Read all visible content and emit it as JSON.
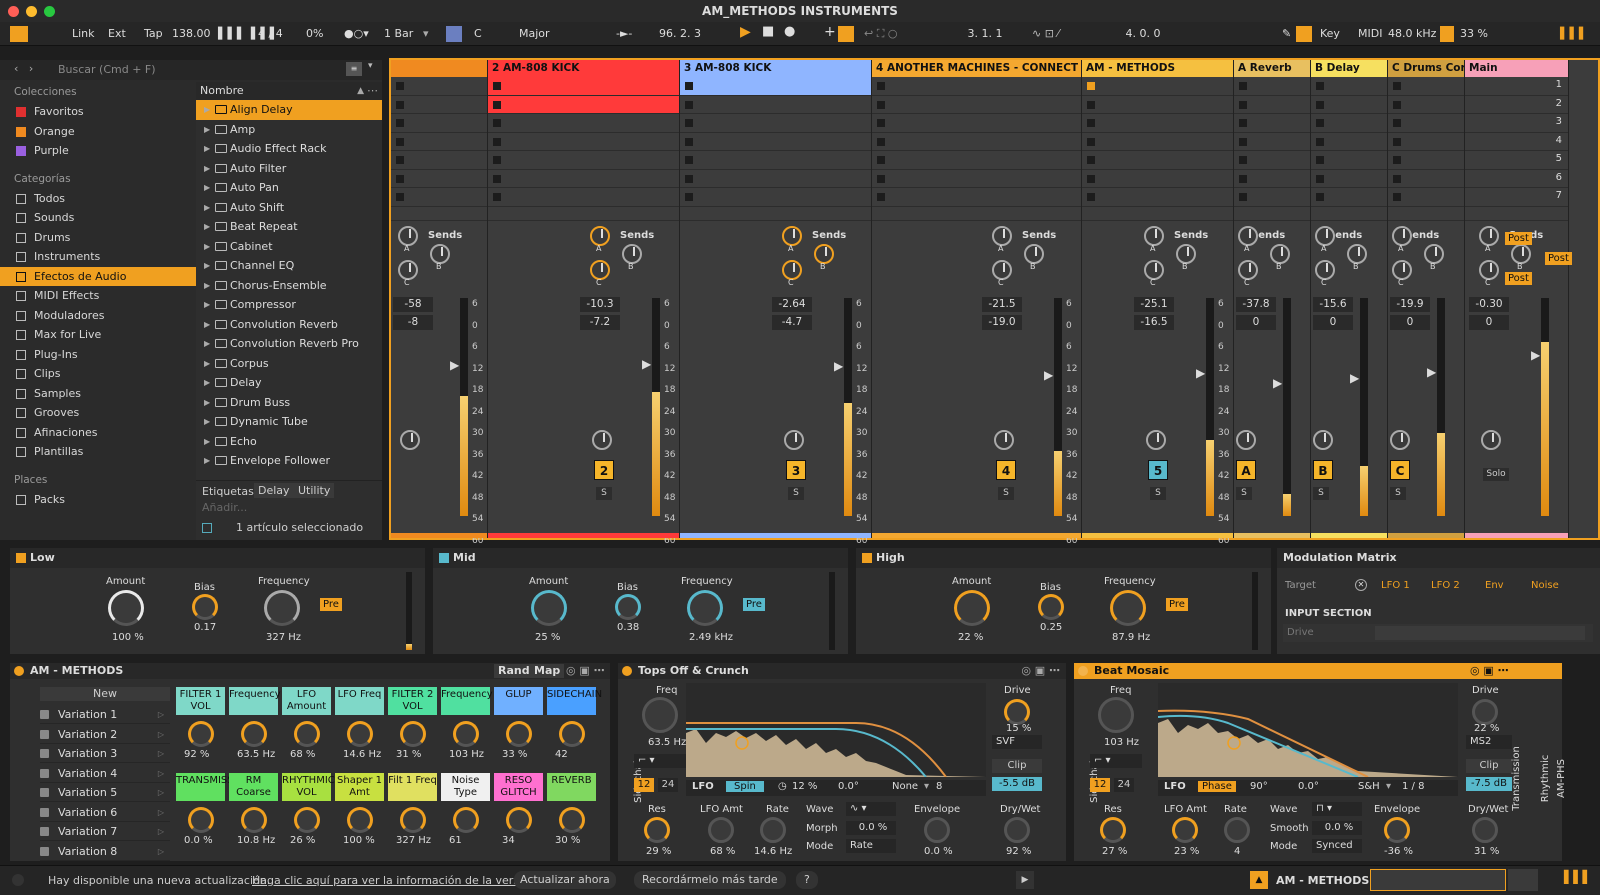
{
  "window": {
    "title": "AM_METHODS INSTRUMENTS"
  },
  "transport": {
    "link": "Link",
    "ext": "Ext",
    "tap": "Tap",
    "tempo": "138.00",
    "signature": "4 / 4",
    "groove": "0%",
    "quant": "1 Bar",
    "key": "C",
    "scale": "Major",
    "position": "96.  2.  3",
    "loop_start": "3.  1.  1",
    "loop_length": "4.  0.  0",
    "key_btn": "Key",
    "midi_btn": "MIDI",
    "sample_rate": "48.0 kHz",
    "cpu": "33 %"
  },
  "browser": {
    "search_placeholder": "Buscar (Cmd + F)",
    "collections_head": "Colecciones",
    "collections": [
      {
        "label": "Favoritos",
        "color": "#e03030"
      },
      {
        "label": "Orange",
        "color": "#f08a20"
      },
      {
        "label": "Purple",
        "color": "#9a60e0"
      }
    ],
    "categories_head": "Categorías",
    "categories": [
      "Todos",
      "Sounds",
      "Drums",
      "Instruments",
      "Efectos de Audio",
      "MIDI Effects",
      "Moduladores",
      "Max for Live",
      "Plug-Ins",
      "Clips",
      "Samples",
      "Grooves",
      "Afinaciones",
      "Plantillas"
    ],
    "places_head": "Places",
    "places": [
      "Packs"
    ],
    "column_head": "Nombre",
    "files": [
      "Align Delay",
      "Amp",
      "Audio Effect Rack",
      "Auto Filter",
      "Auto Pan",
      "Auto Shift",
      "Beat Repeat",
      "Cabinet",
      "Channel EQ",
      "Chorus-Ensemble",
      "Compressor",
      "Convolution Reverb",
      "Convolution Reverb Pro",
      "Corpus",
      "Delay",
      "Drum Buss",
      "Dynamic Tube",
      "Echo",
      "Envelope Follower"
    ],
    "tags_label": "Etiquetas:",
    "tags": [
      "Delay",
      "Utility"
    ],
    "add_tag": "Añadir...",
    "selected_info": "1 artículo seleccionado"
  },
  "session": {
    "tracks": [
      {
        "name": "",
        "color": "#f08a20",
        "vol": "-58",
        "pan": "-8",
        "num": "",
        "meter": 0.55
      },
      {
        "name": "2 AM-808 KICK",
        "color": "#ff3a3a",
        "vol": "-10.3",
        "pan": "-7.2",
        "num": "2",
        "meter": 0.57
      },
      {
        "name": "3 AM-808 KICK",
        "color": "#8fb5ff",
        "vol": "-2.64",
        "pan": "-4.7",
        "num": "3",
        "meter": 0.52
      },
      {
        "name": "4 ANOTHER MACHINES - CONNECT",
        "color": "#f4a830",
        "vol": "-21.5",
        "pan": "-19.0",
        "num": "4",
        "meter": 0.3
      },
      {
        "name": "AM - METHODS",
        "color": "#f5c040",
        "vol": "-25.1",
        "pan": "-16.5",
        "num": "5",
        "meter": 0.35
      },
      {
        "name": "A Reverb",
        "color": "#e8c060",
        "vol": "-37.8",
        "pan": "0",
        "num": "A",
        "meter": 0.1
      },
      {
        "name": "B Delay",
        "color": "#f6e060",
        "vol": "-15.6",
        "pan": "0",
        "num": "B",
        "meter": 0.23
      },
      {
        "name": "C Drums Core",
        "color": "#d0a040",
        "vol": "-19.9",
        "pan": "0",
        "num": "C",
        "meter": 0.38
      },
      {
        "name": "Main",
        "color": "#f7a0b8",
        "vol": "-0.30",
        "pan": "0",
        "num": "",
        "meter": 0.8
      }
    ],
    "sends_label": "Sends",
    "scale": [
      "6",
      "0",
      "6",
      "12",
      "18",
      "24",
      "30",
      "36",
      "42",
      "48",
      "54",
      "60"
    ],
    "scene_numbers": [
      "1",
      "2",
      "3",
      "4",
      "5",
      "6",
      "7"
    ],
    "post_label": "Post",
    "solo_label": "Solo",
    "s_label": "S",
    "send_a": "A",
    "send_b": "B",
    "send_c": "C"
  },
  "eq": {
    "bands": [
      {
        "name": "Low",
        "amount_label": "Amount",
        "amount": "100 %",
        "bias_label": "Bias",
        "bias": "0.17",
        "freq_label": "Frequency",
        "freq": "327 Hz",
        "pre": "Pre"
      },
      {
        "name": "Mid",
        "amount_label": "Amount",
        "amount": "25 %",
        "bias_label": "Bias",
        "bias": "0.38",
        "freq_label": "Frequency",
        "freq": "2.49 kHz",
        "pre": "Pre"
      },
      {
        "name": "High",
        "amount_label": "Amount",
        "amount": "22 %",
        "bias_label": "Bias",
        "bias": "0.25",
        "freq_label": "Frequency",
        "freq": "87.9 Hz",
        "pre": "Pre"
      }
    ],
    "modmatrix": {
      "title": "Modulation Matrix",
      "target": "Target",
      "cols": [
        "LFO 1",
        "LFO 2",
        "Env",
        "Noise"
      ],
      "section": "INPUT SECTION",
      "row": "Drive"
    }
  },
  "rack": {
    "title": "AM - METHODS",
    "rand": "Rand",
    "map": "Map",
    "new": "New",
    "variations": [
      "Variation 1",
      "Variation 2",
      "Variation 3",
      "Variation 4",
      "Variation 5",
      "Variation 6",
      "Variation 7",
      "Variation 8"
    ],
    "macros_row1": [
      {
        "label": "FILTER 1 VOL",
        "value": "92 %",
        "color": "#7fd8c8"
      },
      {
        "label": "Frequency",
        "value": "63.5 Hz",
        "color": "#7fd8c8"
      },
      {
        "label": "LFO Amount",
        "value": "68 %",
        "color": "#7fd8c8"
      },
      {
        "label": "LFO Freq",
        "value": "14.6 Hz",
        "color": "#7fd8c8"
      },
      {
        "label": "FILTER 2 VOL",
        "value": "31 %",
        "color": "#50e0a0"
      },
      {
        "label": "Frequency",
        "value": "103 Hz",
        "color": "#50e0a0"
      },
      {
        "label": "GLUP",
        "value": "33 %",
        "color": "#70b0ff"
      },
      {
        "label": "SIDECHAIN",
        "value": "42",
        "color": "#4aa0ff"
      }
    ],
    "macros_row2": [
      {
        "label": "TRANSMISSION",
        "value": "0.0 %",
        "color": "#60e060"
      },
      {
        "label": "RM Coarse",
        "value": "10.8 Hz",
        "color": "#60e060"
      },
      {
        "label": "RHYTHMIC VOL",
        "value": "26 %",
        "color": "#a8e040"
      },
      {
        "label": "Shaper 1 Amt",
        "value": "100 %",
        "color": "#c8e040"
      },
      {
        "label": "Filt 1 Freq",
        "value": "327 Hz",
        "color": "#e0e060"
      },
      {
        "label": "Noise Type",
        "value": "61",
        "color": "#f0f0f0"
      },
      {
        "label": "RESO GLITCH",
        "value": "34",
        "color": "#ff70d0"
      },
      {
        "label": "REVERB",
        "value": "30 %",
        "color": "#80d860"
      }
    ]
  },
  "crunch": {
    "title": "Tops Off & Crunch",
    "freq_label": "Freq",
    "freq": "63.5 Hz",
    "s12": "12",
    "s24": "24",
    "res_label": "Res",
    "res": "29 %",
    "lfo": "LFO",
    "spin": "Spin",
    "rate_pct": "12 %",
    "phase": "0.0°",
    "none": "None",
    "eight": "8",
    "lfo_amt_label": "LFO Amt",
    "lfo_amt": "68 %",
    "rate_label": "Rate",
    "rate": "14.6 Hz",
    "wave": "Wave",
    "morph": "Morph",
    "morph_val": "0.0 %",
    "mode": "Mode",
    "mode_val": "Rate",
    "env_label": "Envelope",
    "env": "0.0 %",
    "drive_label": "Drive",
    "drive": "15 %",
    "type": "SVF",
    "clip": "Clip",
    "clip_val": "-5.5 dB",
    "dw_label": "Dry/Wet",
    "dw": "92 %",
    "sidechain": "Sidechain"
  },
  "mosaic": {
    "title": "Beat Mosaic",
    "freq_label": "Freq",
    "freq": "103 Hz",
    "s12": "12",
    "s24": "24",
    "res_label": "Res",
    "res": "27 %",
    "lfo": "LFO",
    "phase_btn": "Phase",
    "deg": "90°",
    "phase": "0.0°",
    "sh": "S&H",
    "div": "1 / 8",
    "lfo_amt_label": "LFO Amt",
    "lfo_amt": "23 %",
    "rate_label": "Rate",
    "rate": "4",
    "wave": "Wave",
    "smooth": "Smooth",
    "smooth_val": "0.0 %",
    "mode": "Mode",
    "mode_val": "Synced",
    "env_label": "Envelope",
    "env": "-36 %",
    "drive_label": "Drive",
    "drive": "22 %",
    "type": "MS2",
    "clip": "Clip",
    "clip_val": "-7.5 dB",
    "dw_label": "Dry/Wet",
    "dw": "31 %",
    "sidechain": "Sidechain",
    "side_labels": [
      "Transmission",
      "Rhythmic",
      "AM-PHS"
    ]
  },
  "status": {
    "msg": "Hay disponible una nueva actualización.",
    "link": "Haga clic aquí para ver la información de la versión.",
    "update": "Actualizar ahora",
    "later": "Recordármelo más tarde",
    "q": "?",
    "track": "AM - METHODS"
  }
}
